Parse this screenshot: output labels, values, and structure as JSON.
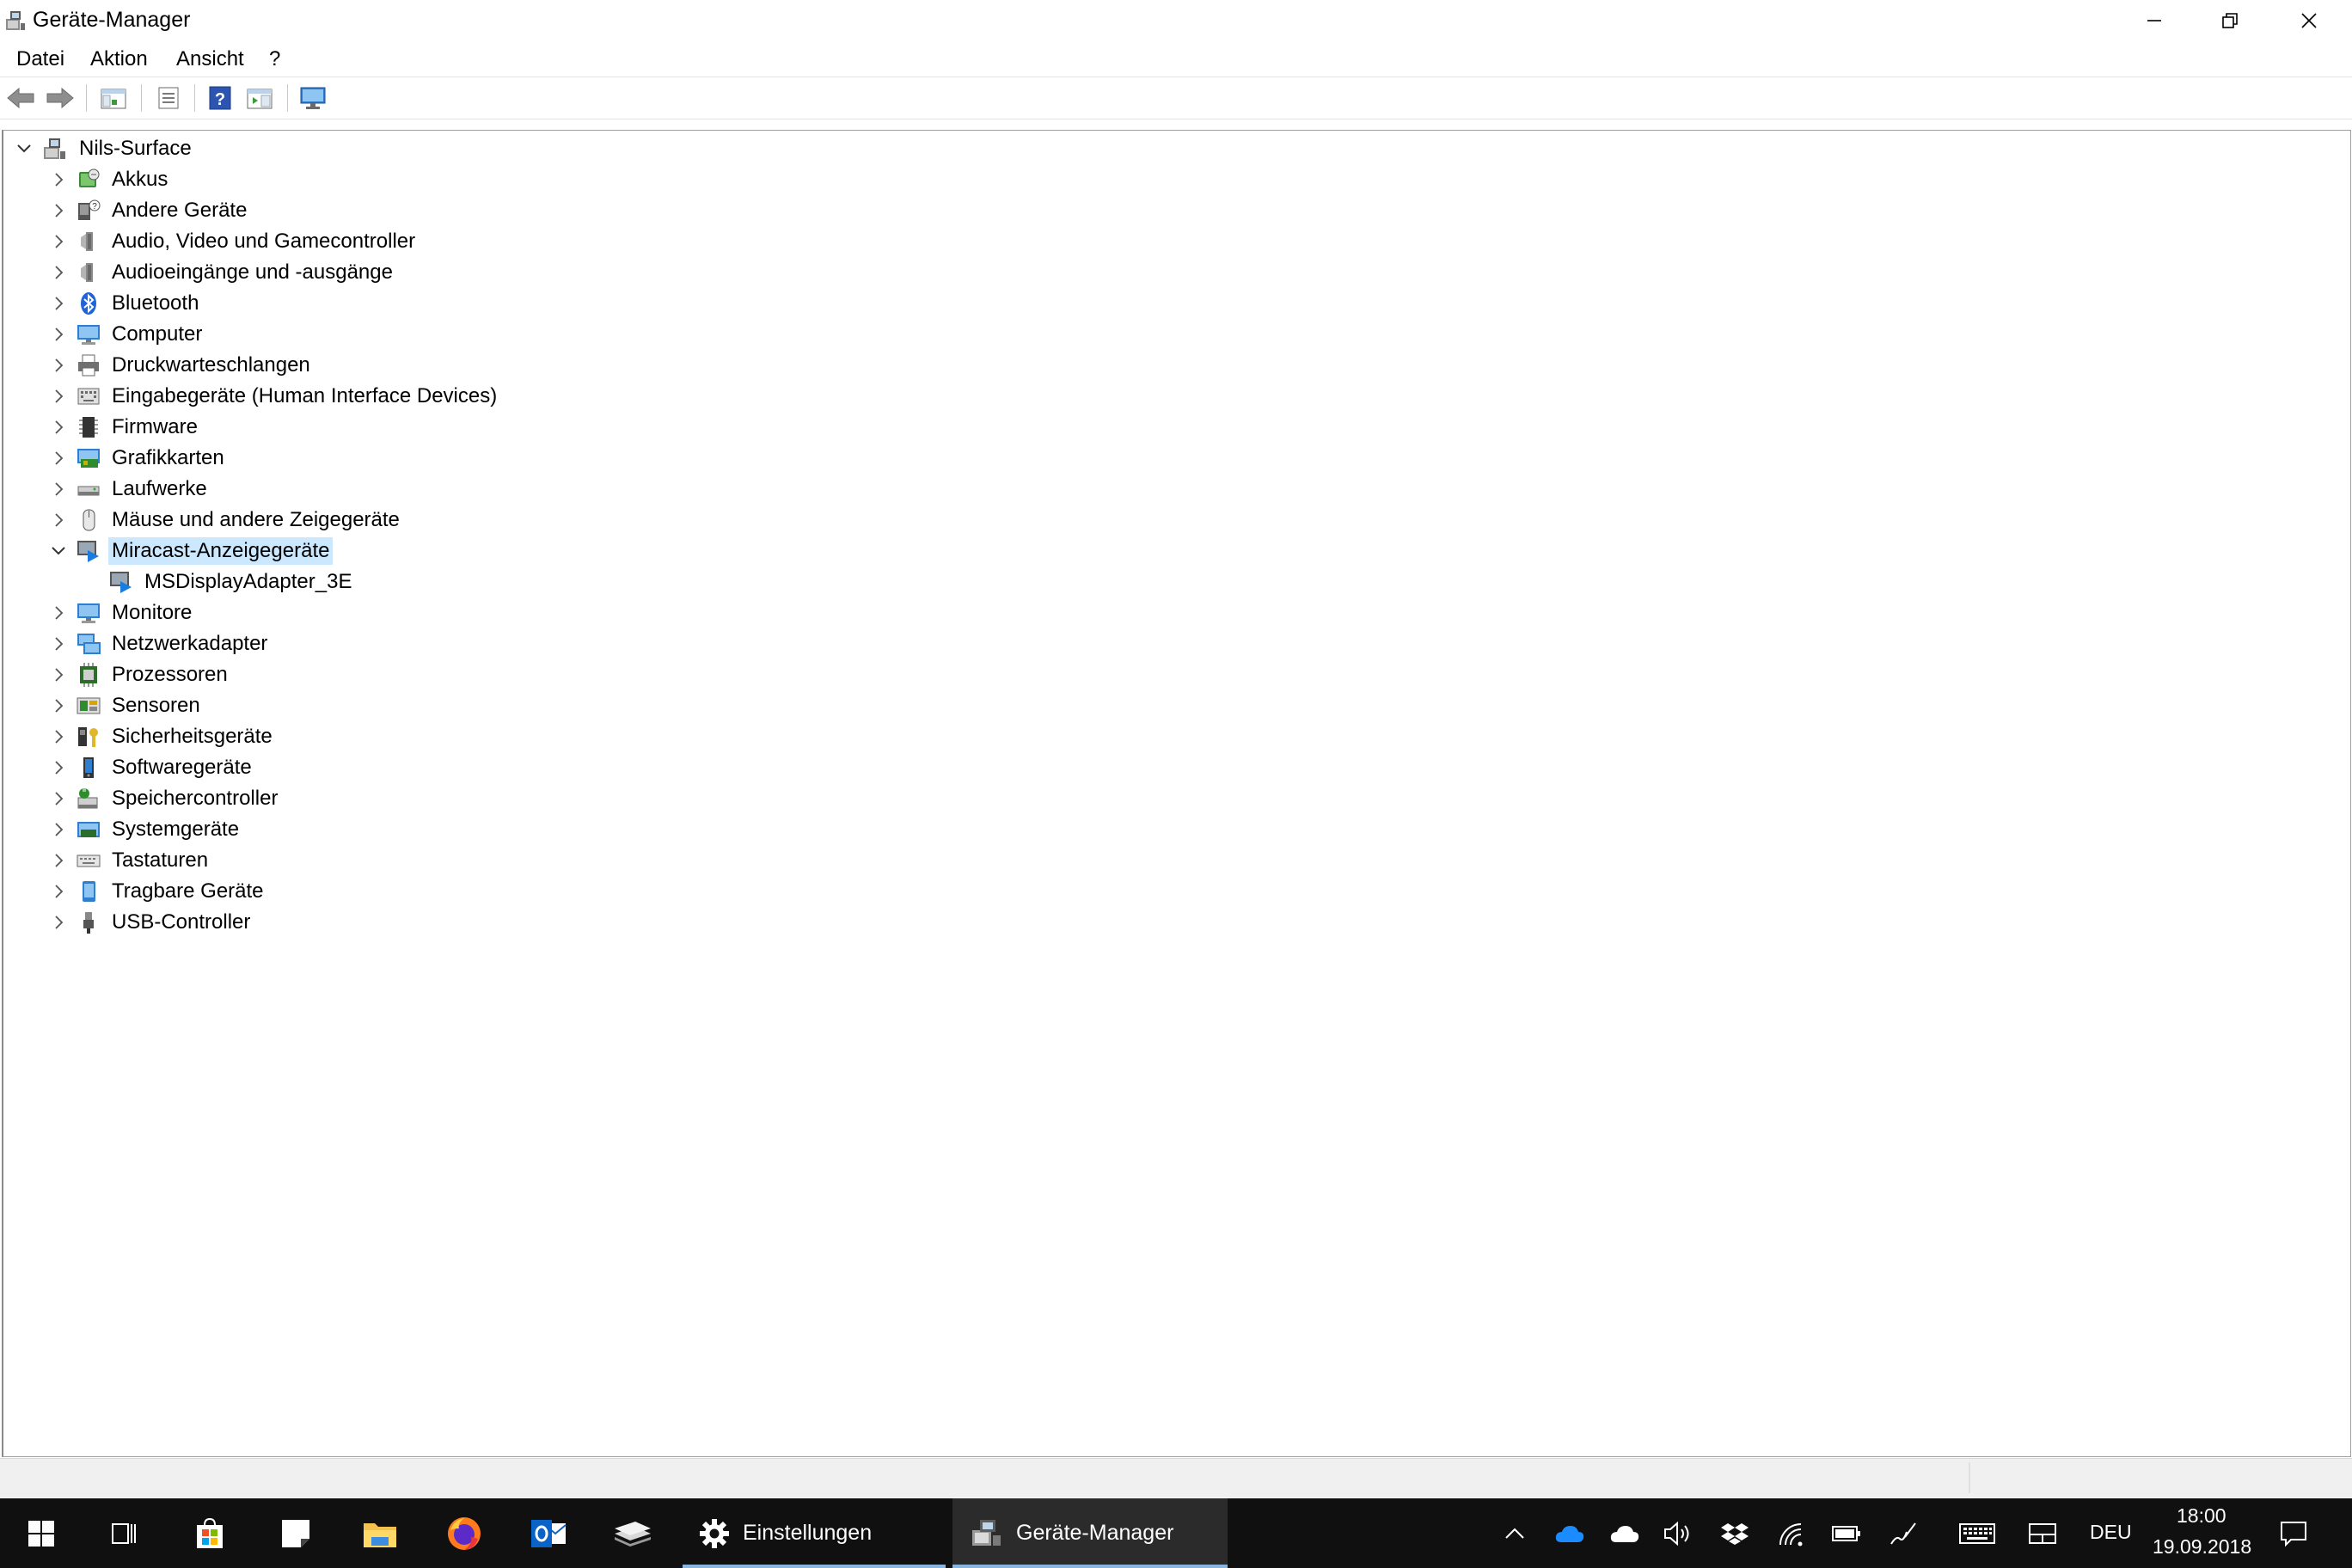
{
  "window": {
    "title": "Geräte-Manager",
    "controls": {
      "minimize": "minimize",
      "restore": "restore",
      "close": "close"
    }
  },
  "menu": [
    "Datei",
    "Aktion",
    "Ansicht",
    "?"
  ],
  "toolbar": {
    "buttons": [
      "back-arrow-icon",
      "forward-arrow-icon",
      "show-hide-console-tree-icon",
      "properties-icon",
      "help-icon",
      "action-pane-icon",
      "scan-hardware-monitor-icon"
    ]
  },
  "tree": {
    "root": "Nils-Surface",
    "categories": [
      {
        "label": "Akkus",
        "icon": "battery-icon"
      },
      {
        "label": "Andere Geräte",
        "icon": "unknown-device-icon"
      },
      {
        "label": "Audio, Video und Gamecontroller",
        "icon": "speaker-icon"
      },
      {
        "label": "Audioeingänge und -ausgänge",
        "icon": "speaker-icon"
      },
      {
        "label": "Bluetooth",
        "icon": "bluetooth-icon"
      },
      {
        "label": "Computer",
        "icon": "monitor-icon"
      },
      {
        "label": "Druckwarteschlangen",
        "icon": "printer-icon"
      },
      {
        "label": "Eingabegeräte (Human Interface Devices)",
        "icon": "hid-icon"
      },
      {
        "label": "Firmware",
        "icon": "firmware-chip-icon"
      },
      {
        "label": "Grafikkarten",
        "icon": "display-adapter-icon"
      },
      {
        "label": "Laufwerke",
        "icon": "disk-drive-icon"
      },
      {
        "label": "Mäuse und andere Zeigegeräte",
        "icon": "mouse-icon"
      },
      {
        "label": "Miracast-Anzeigegeräte",
        "icon": "miracast-icon",
        "expanded": true,
        "selected": true,
        "children": [
          {
            "label": "MSDisplayAdapter_3E",
            "icon": "miracast-icon"
          }
        ]
      },
      {
        "label": "Monitore",
        "icon": "monitor-icon"
      },
      {
        "label": "Netzwerkadapter",
        "icon": "network-adapter-icon"
      },
      {
        "label": "Prozessoren",
        "icon": "processor-icon"
      },
      {
        "label": "Sensoren",
        "icon": "sensor-icon"
      },
      {
        "label": "Sicherheitsgeräte",
        "icon": "security-key-icon"
      },
      {
        "label": "Softwaregeräte",
        "icon": "software-device-icon"
      },
      {
        "label": "Speichercontroller",
        "icon": "storage-controller-icon"
      },
      {
        "label": "Systemgeräte",
        "icon": "system-device-icon"
      },
      {
        "label": "Tastaturen",
        "icon": "keyboard-icon"
      },
      {
        "label": "Tragbare Geräte",
        "icon": "portable-device-icon"
      },
      {
        "label": "USB-Controller",
        "icon": "usb-icon"
      }
    ]
  },
  "taskbar": {
    "pinned": [
      "windows-start-icon",
      "task-view-icon",
      "store-icon",
      "sticky-notes-icon",
      "file-explorer-icon",
      "firefox-icon",
      "outlook-icon",
      "stack-app-icon"
    ],
    "running": [
      {
        "label": "Einstellungen",
        "icon": "gear-icon"
      },
      {
        "label": "Geräte-Manager",
        "icon": "device-manager-icon",
        "active": true
      }
    ],
    "tray": {
      "language": "DEU",
      "time": "18:00",
      "date": "19.09.2018"
    }
  },
  "colors": {
    "selection": "#cce8ff",
    "taskbar": "#101010",
    "accent": "#0078d7"
  }
}
